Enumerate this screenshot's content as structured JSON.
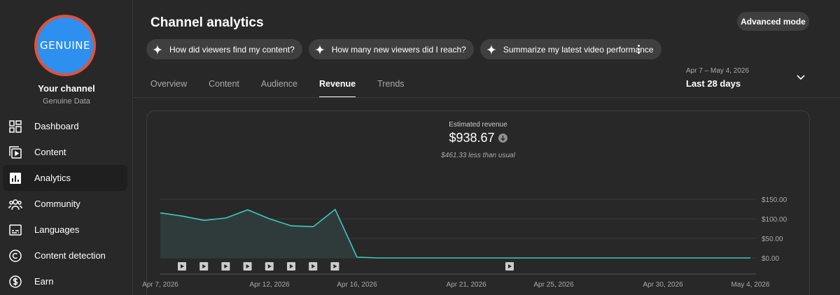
{
  "sidebar": {
    "avatar_text": "GENUINE",
    "channel_name": "Your channel",
    "channel_sub": "Genuine Data",
    "items": [
      {
        "label": "Dashboard",
        "icon": "dashboard-icon"
      },
      {
        "label": "Content",
        "icon": "content-icon"
      },
      {
        "label": "Analytics",
        "icon": "analytics-icon",
        "active": true
      },
      {
        "label": "Community",
        "icon": "community-icon"
      },
      {
        "label": "Languages",
        "icon": "languages-icon"
      },
      {
        "label": "Content detection",
        "icon": "copyright-icon"
      },
      {
        "label": "Earn",
        "icon": "dollar-icon"
      }
    ]
  },
  "header": {
    "title": "Channel analytics",
    "advanced_mode": "Advanced mode",
    "chips": [
      "How did viewers find my content?",
      "How many new viewers did I reach?",
      "Summarize my latest video performance"
    ]
  },
  "tabs": [
    {
      "label": "Overview"
    },
    {
      "label": "Content"
    },
    {
      "label": "Audience"
    },
    {
      "label": "Revenue",
      "active": true
    },
    {
      "label": "Trends"
    }
  ],
  "date": {
    "range": "Apr 7 – May 4, 2026",
    "label": "Last 28 days"
  },
  "metric": {
    "label": "Estimated revenue",
    "value": "$938.67",
    "note": "$461.33 less than usual"
  },
  "colors": {
    "line": "#3ec9c4",
    "area": "#2f3b3b",
    "grid": "#3a3a3a"
  },
  "chart_data": {
    "type": "area",
    "y_ticks": [
      "$150.00",
      "$100.00",
      "$50.00",
      "$0.00"
    ],
    "ylim": [
      0,
      150
    ],
    "x_tick_labels": [
      {
        "label": "Apr 7, 2026",
        "day": 0
      },
      {
        "label": "Apr 12, 2026",
        "day": 5
      },
      {
        "label": "Apr 16, 2026",
        "day": 9
      },
      {
        "label": "Apr 21, 2026",
        "day": 14
      },
      {
        "label": "Apr 25, 2026",
        "day": 18
      },
      {
        "label": "Apr 30, 2026",
        "day": 23
      },
      {
        "label": "May 4, 2026",
        "day": 27
      }
    ],
    "series": [
      {
        "values": [
          115,
          107,
          96,
          102,
          123,
          100,
          82,
          80,
          124,
          2,
          0,
          0,
          0,
          0,
          0,
          0,
          0,
          0,
          0,
          0,
          0,
          0,
          0,
          0,
          0,
          0,
          0,
          0
        ]
      }
    ],
    "video_markers": [
      0,
      1,
      2,
      3,
      4,
      5,
      6,
      7,
      15
    ]
  }
}
